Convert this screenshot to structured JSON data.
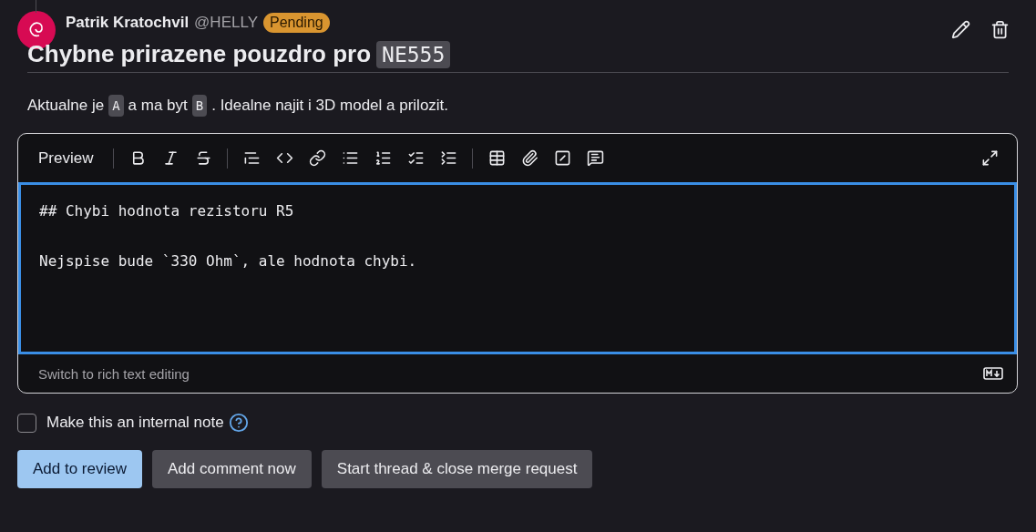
{
  "author": {
    "name": "Patrik Kratochvil",
    "handle": "@HELLY",
    "badge": "Pending"
  },
  "title": [
    {
      "kind": "text",
      "text": "Chybne prirazene pouzdro pro"
    },
    {
      "kind": "code",
      "text": "NE555"
    }
  ],
  "description": [
    {
      "kind": "text",
      "text": "Aktualne je"
    },
    {
      "kind": "code",
      "text": "A"
    },
    {
      "kind": "text",
      "text": "a ma byt"
    },
    {
      "kind": "code",
      "text": "B"
    },
    {
      "kind": "text",
      "text": ". Idealne najit i 3D model a prilozit."
    }
  ],
  "editor": {
    "preview_tab": "Preview",
    "value": "## Chybi hodnota rezistoru R5\n\nNejspise bude `330 Ohm`, ale hodnota chybi.",
    "switch_link": "Switch to rich text editing"
  },
  "internal_note": {
    "label": "Make this an internal note",
    "checked": false
  },
  "buttons": [
    {
      "label": "Add to review",
      "kind": "primary"
    },
    {
      "label": "Add comment now",
      "kind": "secondary"
    },
    {
      "label": "Start thread & close merge request",
      "kind": "secondary"
    }
  ]
}
